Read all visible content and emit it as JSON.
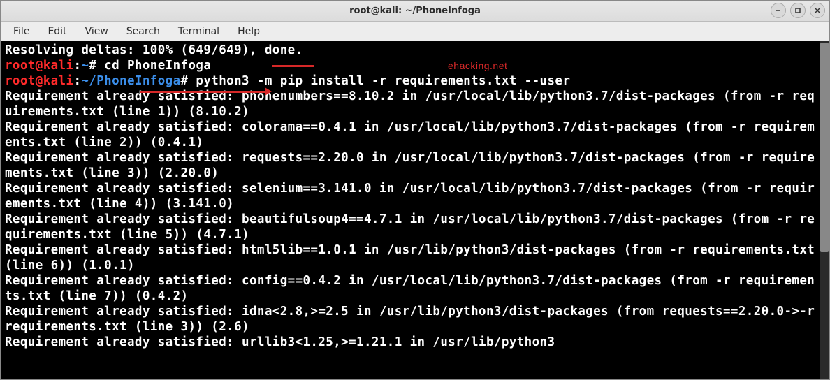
{
  "titlebar": {
    "title": "root@kali: ~/PhoneInfoga"
  },
  "window_controls": {
    "minimize": "minimize-icon",
    "maximize": "maximize-icon",
    "close": "close-icon"
  },
  "menubar": {
    "file": "File",
    "edit": "Edit",
    "view": "View",
    "search": "Search",
    "terminal": "Terminal",
    "help": "Help"
  },
  "watermark": "ehacking.net",
  "terminal": {
    "line1": "Resolving deltas: 100% (649/649), done.",
    "prompt1_user": "root",
    "prompt1_at": "@",
    "prompt1_host": "kali",
    "prompt1_colon": ":",
    "prompt1_path": "~",
    "prompt1_hash": "#",
    "cmd1": " cd PhoneInfoga",
    "prompt2_user": "root",
    "prompt2_at": "@",
    "prompt2_host": "kali",
    "prompt2_colon": ":",
    "prompt2_path": "~/PhoneInfoga",
    "prompt2_hash": "#",
    "cmd2": " python3 -m pip install -r requirements.txt --user",
    "out1": "Requirement already satisfied: phonenumbers==8.10.2 in /usr/local/lib/python3.7/dist-packages (from -r requirements.txt (line 1)) (8.10.2)",
    "out2": "Requirement already satisfied: colorama==0.4.1 in /usr/local/lib/python3.7/dist-packages (from -r requirements.txt (line 2)) (0.4.1)",
    "out3": "Requirement already satisfied: requests==2.20.0 in /usr/local/lib/python3.7/dist-packages (from -r requirements.txt (line 3)) (2.20.0)",
    "out4": "Requirement already satisfied: selenium==3.141.0 in /usr/local/lib/python3.7/dist-packages (from -r requirements.txt (line 4)) (3.141.0)",
    "out5": "Requirement already satisfied: beautifulsoup4==4.7.1 in /usr/local/lib/python3.7/dist-packages (from -r requirements.txt (line 5)) (4.7.1)",
    "out6": "Requirement already satisfied: html5lib==1.0.1 in /usr/lib/python3/dist-packages (from -r requirements.txt (line 6)) (1.0.1)",
    "out7": "Requirement already satisfied: config==0.4.2 in /usr/local/lib/python3.7/dist-packages (from -r requirements.txt (line 7)) (0.4.2)",
    "out8": "Requirement already satisfied: idna<2.8,>=2.5 in /usr/lib/python3/dist-packages (from requests==2.20.0->-r requirements.txt (line 3)) (2.6)",
    "out9": "Requirement already satisfied: urllib3<1.25,>=1.21.1 in /usr/lib/python3"
  }
}
